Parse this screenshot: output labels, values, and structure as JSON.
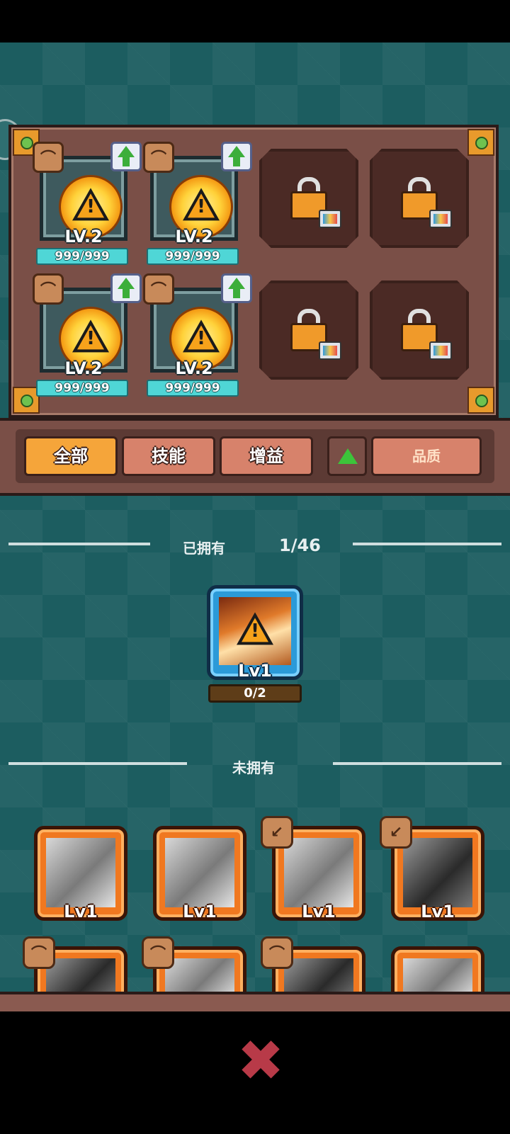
{
  "equipped_slots": [
    {
      "level": "LV.2",
      "count": "999/999"
    },
    {
      "level": "LV.2",
      "count": "999/999"
    },
    {
      "level": "LV.2",
      "count": "999/999"
    },
    {
      "level": "LV.2",
      "count": "999/999"
    }
  ],
  "filters": {
    "all": "全部",
    "skill": "技能",
    "buff": "增益",
    "quality": "品质",
    "active": "all"
  },
  "owned_section": {
    "label": "已拥有",
    "count": "1/46"
  },
  "owned_cards": [
    {
      "level": "Lv1",
      "fragments": "0/2"
    }
  ],
  "unowned_section": {
    "label": "未拥有"
  },
  "unowned_cards": [
    {
      "level": "Lv1"
    },
    {
      "level": "Lv1"
    },
    {
      "level": "Lv1"
    },
    {
      "level": "Lv1"
    }
  ],
  "colors": {
    "background": "#1c5d60",
    "panel": "#7a4f47",
    "active_filter": "#f5a53a",
    "close": "#b83a48"
  }
}
